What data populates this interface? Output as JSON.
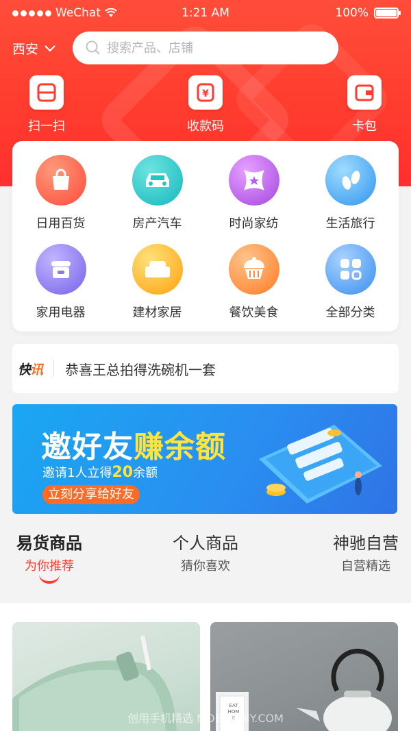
{
  "status": {
    "carrier": "WeChat",
    "time": "1:21 AM",
    "battery": "100%"
  },
  "header": {
    "city": "西安",
    "search_placeholder": "搜索产品、店铺"
  },
  "quick_actions": [
    {
      "label": "扫一扫",
      "icon": "scan-icon"
    },
    {
      "label": "收款码",
      "icon": "payment-code-icon"
    },
    {
      "label": "卡包",
      "icon": "wallet-icon"
    }
  ],
  "categories": [
    {
      "label": "日用百货",
      "icon": "shopping-bag-icon",
      "color": "#ff5a4a"
    },
    {
      "label": "房产汽车",
      "icon": "car-icon",
      "color": "#25c5c7"
    },
    {
      "label": "时尚家纺",
      "icon": "pillow-icon",
      "color": "#b85de8"
    },
    {
      "label": "生活旅行",
      "icon": "footprint-icon",
      "color": "#3fa8f5"
    },
    {
      "label": "家用电器",
      "icon": "rice-cooker-icon",
      "color": "#8a78ee"
    },
    {
      "label": "建材家居",
      "icon": "sofa-icon",
      "color": "#ffb21e"
    },
    {
      "label": "餐饮美食",
      "icon": "cupcake-icon",
      "color": "#ff8a3a"
    },
    {
      "label": "全部分类",
      "icon": "grid-icon",
      "color": "#4d9ff2"
    }
  ],
  "news": {
    "tag_a": "快",
    "tag_b": "讯",
    "text": "恭喜王总拍得洗碗机一套"
  },
  "banner": {
    "title_a": "邀好友",
    "title_b": "赚余额",
    "sub_a": "邀请1人立得",
    "sub_amount": "20",
    "sub_b": "余额",
    "button": "立刻分享给好友"
  },
  "tabs": [
    {
      "title": "易货商品",
      "subtitle": "为你推荐",
      "active": true
    },
    {
      "title": "个人商品",
      "subtitle": "猜你喜欢",
      "active": false
    },
    {
      "title": "神驰自营",
      "subtitle": "自营精选",
      "active": false
    }
  ],
  "product_sign": "EAT HOME",
  "watermark": "创用手机精选 MOBILEUIY.COM"
}
